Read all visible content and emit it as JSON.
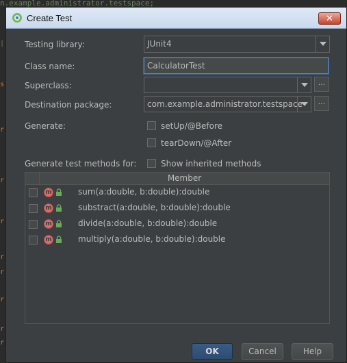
{
  "background": {
    "code_fragment": "n.example.administrator.testspace;"
  },
  "dialog": {
    "title": "Create Test",
    "close_label": "✕",
    "colors": {
      "bg": "#3c3f41",
      "accent": "#2f4c70",
      "method_icon": "#d96b6b",
      "lock": "#6aab5a"
    }
  },
  "form": {
    "testing_library": {
      "label": "Testing library:",
      "value": "JUnit4"
    },
    "class_name": {
      "label": "Class name:",
      "value": "CalculatorTest"
    },
    "superclass": {
      "label": "Superclass:",
      "value": "",
      "browse_label": "..."
    },
    "destination_package": {
      "label": "Destination package:",
      "value": "com.example.administrator.testspace",
      "browse_label": "..."
    },
    "generate": {
      "label": "Generate:",
      "options": [
        {
          "label": "setUp/@Before",
          "checked": false
        },
        {
          "label": "tearDown/@After",
          "checked": false
        }
      ]
    },
    "methods_section": {
      "label": "Generate test methods for:",
      "show_inherited_label": "Show inherited methods",
      "show_inherited_checked": false
    }
  },
  "table": {
    "column_header": "Member",
    "rows": [
      {
        "icon": "method-icon",
        "icon_letter": "m",
        "text": "sum(a:double, b:double):double",
        "checked": false
      },
      {
        "icon": "method-icon",
        "icon_letter": "m",
        "text": "substract(a:double, b:double):double",
        "checked": false
      },
      {
        "icon": "method-icon",
        "icon_letter": "m",
        "text": "divide(a:double, b:double):double",
        "checked": false
      },
      {
        "icon": "method-icon",
        "icon_letter": "m",
        "text": "multiply(a:double, b:double):double",
        "checked": false
      }
    ]
  },
  "buttons": {
    "ok": "OK",
    "cancel": "Cancel",
    "help": "Help"
  }
}
